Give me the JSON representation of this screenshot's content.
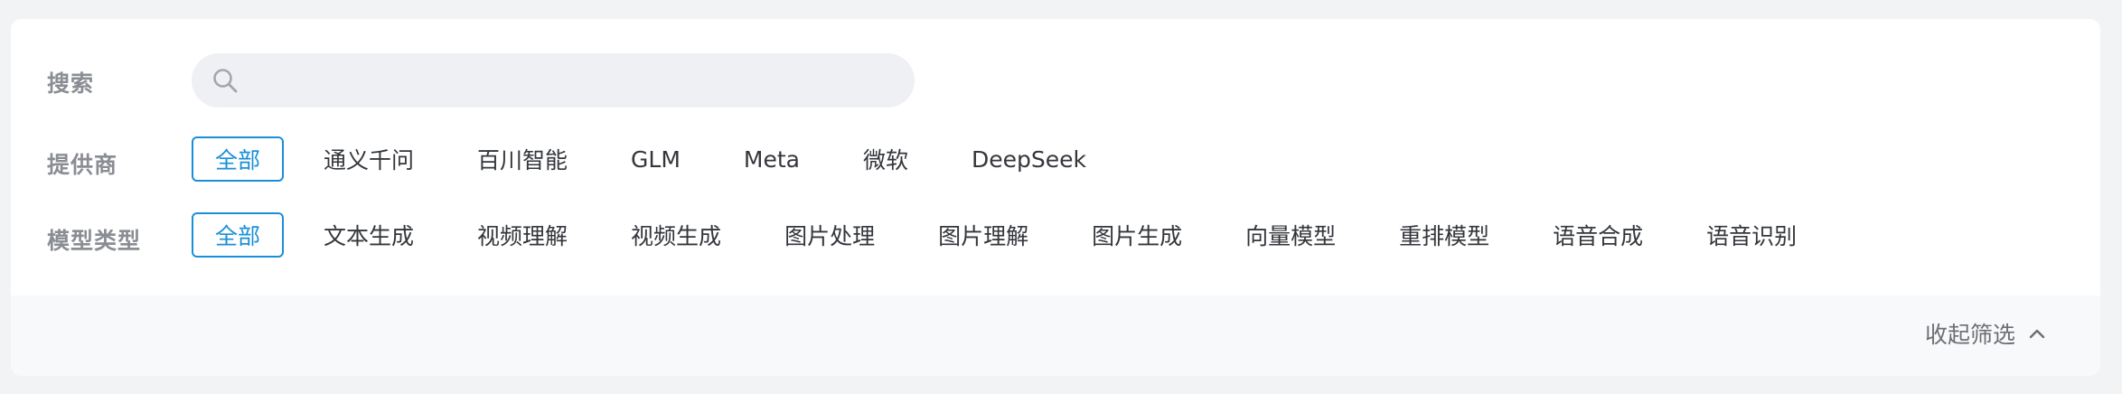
{
  "search": {
    "label": "搜索",
    "placeholder": "",
    "value": ""
  },
  "provider": {
    "label": "提供商",
    "options": [
      "全部",
      "通义千问",
      "百川智能",
      "GLM",
      "Meta",
      "微软",
      "DeepSeek"
    ],
    "selected": "全部"
  },
  "model_type": {
    "label": "模型类型",
    "options": [
      "全部",
      "文本生成",
      "视频理解",
      "视频生成",
      "图片处理",
      "图片理解",
      "图片生成",
      "向量模型",
      "重排模型",
      "语音合成",
      "语音识别"
    ],
    "selected": "全部"
  },
  "footer": {
    "collapse_label": "收起筛选",
    "collapse_icon": "chevron-up-icon"
  },
  "colors": {
    "accent": "#1a8fd9",
    "label": "#8a8d93",
    "text": "#33363b",
    "search_bg": "#eef0f4",
    "page_bg": "#f2f3f5",
    "footer_bg": "#f8f9fb"
  }
}
